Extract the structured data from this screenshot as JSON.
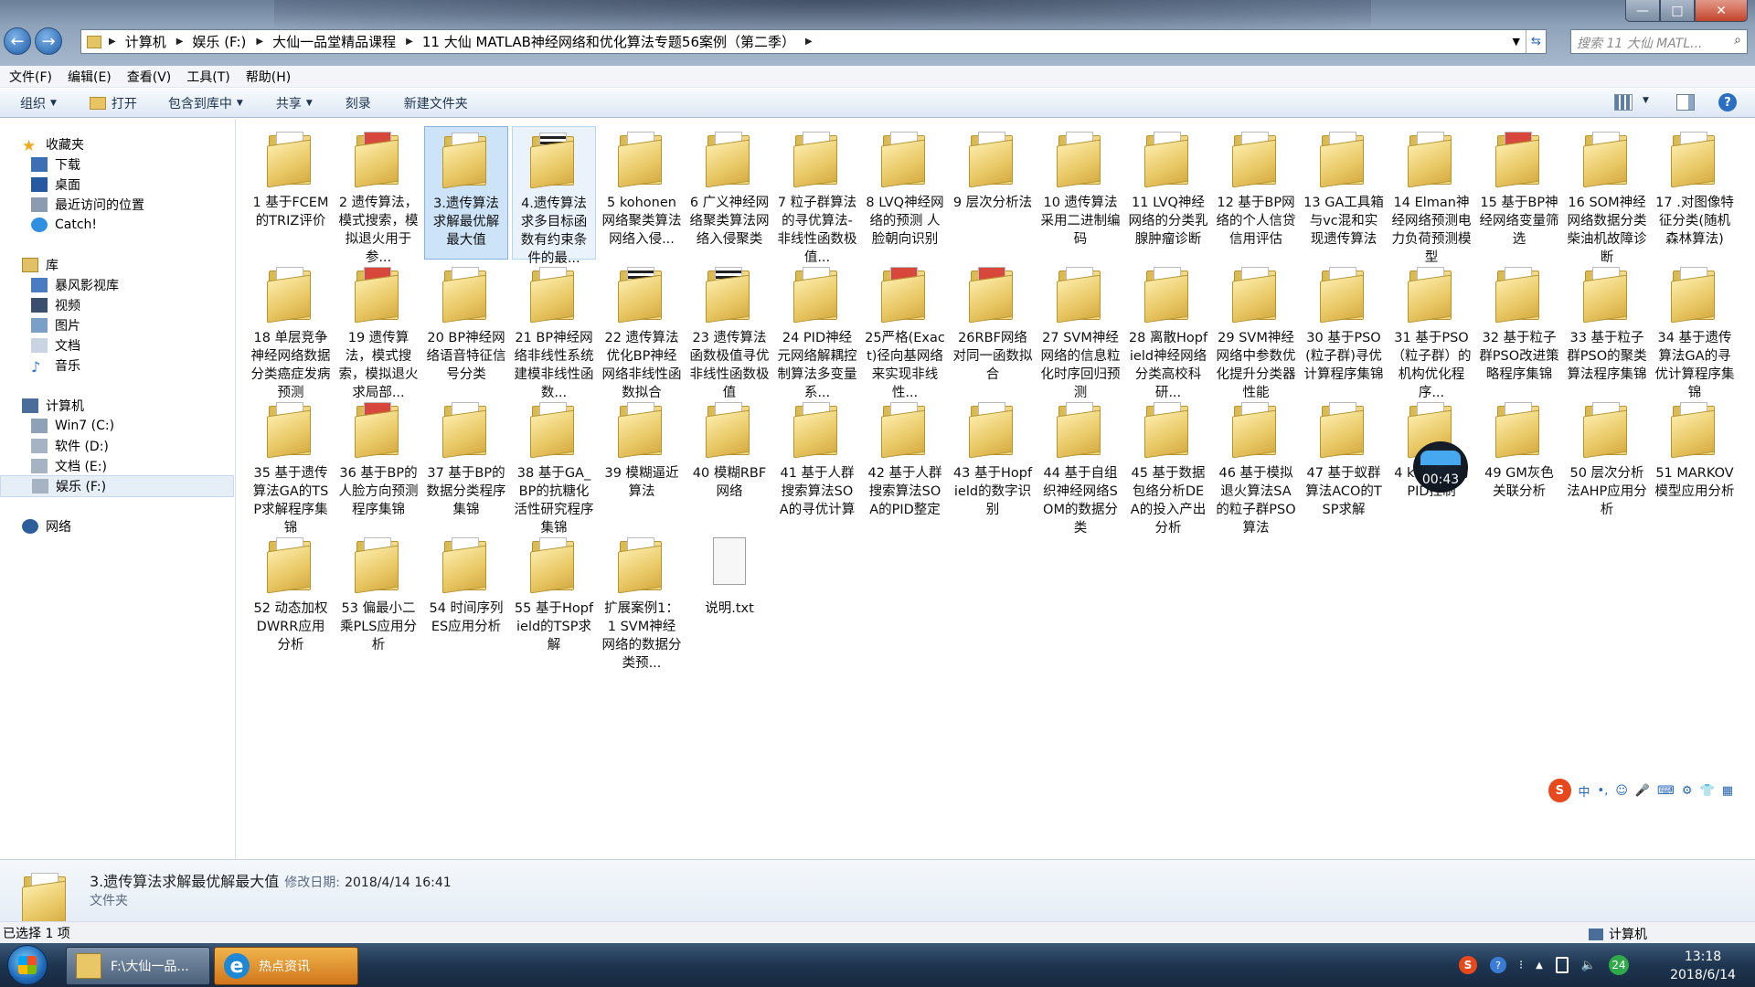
{
  "window": {
    "address": [
      "计算机",
      "娱乐 (F:)",
      "大仙一品堂精品课程",
      "11 大仙 MATLAB神经网络和优化算法专题56案例（第二季）"
    ],
    "search_placeholder": "搜索 11 大仙 MATL...",
    "controls": {
      "minimize": "—",
      "maximize": "□",
      "close": "✕"
    }
  },
  "menu": [
    "文件(F)",
    "编辑(E)",
    "查看(V)",
    "工具(T)",
    "帮助(H)"
  ],
  "toolbar": {
    "organize": "组织",
    "open": "打开",
    "include": "包含到库中",
    "share": "共享",
    "burn": "刻录",
    "new_folder": "新建文件夹"
  },
  "sidebar": {
    "favorites": "收藏夹",
    "fav_items": [
      "下载",
      "桌面",
      "最近访问的位置",
      "Catch!"
    ],
    "libraries": "库",
    "lib_items": [
      "暴风影视库",
      "视频",
      "图片",
      "文档",
      "音乐"
    ],
    "computer": "计算机",
    "drives": [
      "Win7 (C:)",
      "软件 (D:)",
      "文档 (E:)",
      "娱乐 (F:)"
    ],
    "network": "网络"
  },
  "files": [
    {
      "name": "1 基于FCEM的TRIZ评价",
      "icon": "folder"
    },
    {
      "name": "2 遗传算法，模式搜索，模拟退火用于参...",
      "icon": "folder-red"
    },
    {
      "name": "3.遗传算法求解最优解最大值",
      "icon": "folder",
      "state": "selected"
    },
    {
      "name": "4.遗传算法求多目标函数有约束条件的最...",
      "icon": "folder-qr",
      "state": "hover"
    },
    {
      "name": "5 kohonen网络聚类算法网络入侵...",
      "icon": "folder-pink"
    },
    {
      "name": "6 广义神经网络聚类算法网络入侵聚类",
      "icon": "folder"
    },
    {
      "name": "7 粒子群算法的寻优算法-非线性函数极值...",
      "icon": "folder"
    },
    {
      "name": "8 LVQ神经网络的预测 人脸朝向识别",
      "icon": "folder"
    },
    {
      "name": "9 层次分析法",
      "icon": "folder"
    },
    {
      "name": "10 遗传算法采用二进制编码",
      "icon": "folder"
    },
    {
      "name": "11 LVQ神经网络的分类乳腺肿瘤诊断",
      "icon": "folder"
    },
    {
      "name": "12 基于BP网络的个人信贷信用评估",
      "icon": "folder"
    },
    {
      "name": "13 GA工具箱与vc混和实现遗传算法",
      "icon": "folder"
    },
    {
      "name": "14 Elman神经网络预测电力负荷预测模型",
      "icon": "folder"
    },
    {
      "name": "15 基于BP神经网络变量筛选",
      "icon": "folder-red"
    },
    {
      "name": "16 SOM神经网络数据分类柴油机故障诊断",
      "icon": "folder"
    },
    {
      "name": "17 .对图像特征分类(随机森林算法)",
      "icon": "folder"
    },
    {
      "name": "18 单层竞争神经网络数据分类癌症发病预测",
      "icon": "folder"
    },
    {
      "name": "19 遗传算法，模式搜索，模拟退火求局部...",
      "icon": "folder-red"
    },
    {
      "name": "20 BP神经网络语音特征信号分类",
      "icon": "folder"
    },
    {
      "name": "21 BP神经网络非线性系统建模非线性函数...",
      "icon": "folder"
    },
    {
      "name": "22 遗传算法优化BP神经网络非线性函数拟合",
      "icon": "folder-qr"
    },
    {
      "name": "23 遗传算法函数极值寻优非线性函数极值",
      "icon": "folder-qr"
    },
    {
      "name": "24 PID神经元网络解耦控制算法多变量系...",
      "icon": "folder"
    },
    {
      "name": "25严格(Exact)径向基网络来实现非线性...",
      "icon": "folder-red"
    },
    {
      "name": "26RBF网络对同一函数拟合",
      "icon": "folder-red"
    },
    {
      "name": "27 SVM神经网络的信息粒化时序回归预测",
      "icon": "folder"
    },
    {
      "name": "28 离散Hopfield神经网络分类高校科研...",
      "icon": "folder"
    },
    {
      "name": "29 SVM神经网络中参数优化提升分类器性能",
      "icon": "folder"
    },
    {
      "name": "30 基于PSO(粒子群)寻优计算程序集锦",
      "icon": "folder"
    },
    {
      "name": "31 基于PSO（粒子群）的机构优化程序...",
      "icon": "folder"
    },
    {
      "name": "32 基于粒子群PSO改进策略程序集锦",
      "icon": "folder"
    },
    {
      "name": "33 基于粒子群PSO的聚类算法程序集锦",
      "icon": "folder"
    },
    {
      "name": "34 基于遗传算法GA的寻优计算程序集锦",
      "icon": "folder"
    },
    {
      "name": "35 基于遗传算法GA的TSP求解程序集锦",
      "icon": "folder"
    },
    {
      "name": "36 基于BP的人脸方向预测程序集锦",
      "icon": "folder-red"
    },
    {
      "name": "37 基于BP的数据分类程序集锦",
      "icon": "folder"
    },
    {
      "name": "38 基于GA_BP的抗糖化活性研究程序集锦",
      "icon": "folder"
    },
    {
      "name": "39 模糊逼近算法",
      "icon": "folder"
    },
    {
      "name": "40 模糊RBF网络",
      "icon": "folder"
    },
    {
      "name": "41 基于人群搜索算法SOA的寻优计算",
      "icon": "folder"
    },
    {
      "name": "42 基于人群搜索算法SOA的PID整定",
      "icon": "folder"
    },
    {
      "name": "43 基于Hopfield的数字识别",
      "icon": "folder"
    },
    {
      "name": "44 基于自组织神经网络SOM的数据分类",
      "icon": "folder"
    },
    {
      "name": "45 基于数据包络分析DEA的投入产出分析",
      "icon": "folder"
    },
    {
      "name": "46 基于模拟退火算法SA的粒子群PSO算法",
      "icon": "folder"
    },
    {
      "name": "47 基于蚁群算法ACO的TSP求解",
      "icon": "folder"
    },
    {
      "name": "4 kalman的PID控制",
      "icon": "folder"
    },
    {
      "name": "49 GM灰色关联分析",
      "icon": "folder"
    },
    {
      "name": "50 层次分析法AHP应用分析",
      "icon": "folder"
    },
    {
      "name": "51 MARKOV模型应用分析",
      "icon": "folder"
    },
    {
      "name": "52 动态加权DWRR应用分析",
      "icon": "folder"
    },
    {
      "name": "53 偏最小二乘PLS应用分析",
      "icon": "folder"
    },
    {
      "name": "54 时间序列ES应用分析",
      "icon": "folder"
    },
    {
      "name": "55 基于Hopfield的TSP求解",
      "icon": "folder"
    },
    {
      "name": "扩展案例1：1 SVM神经网络的数据分类预...",
      "icon": "folder"
    },
    {
      "name": "说明.txt",
      "icon": "text-file"
    }
  ],
  "overlay_timer": "00:43",
  "ime": {
    "logo": "S",
    "items": [
      "中",
      "•,",
      "☺",
      "🎤",
      "⌨",
      "⚙",
      "👕",
      "▦"
    ]
  },
  "details": {
    "name": "3.遗传算法求解最优解最大值",
    "modified_label": "修改日期:",
    "modified": "2018/4/14 16:41",
    "type": "文件夹"
  },
  "status": {
    "left": "已选择 1 项",
    "right": "计算机"
  },
  "taskbar": {
    "tasks": [
      "F:\\大仙一品...",
      "热点资讯"
    ],
    "tray_badge": "24",
    "time": "13:18",
    "date": "2018/6/14"
  }
}
